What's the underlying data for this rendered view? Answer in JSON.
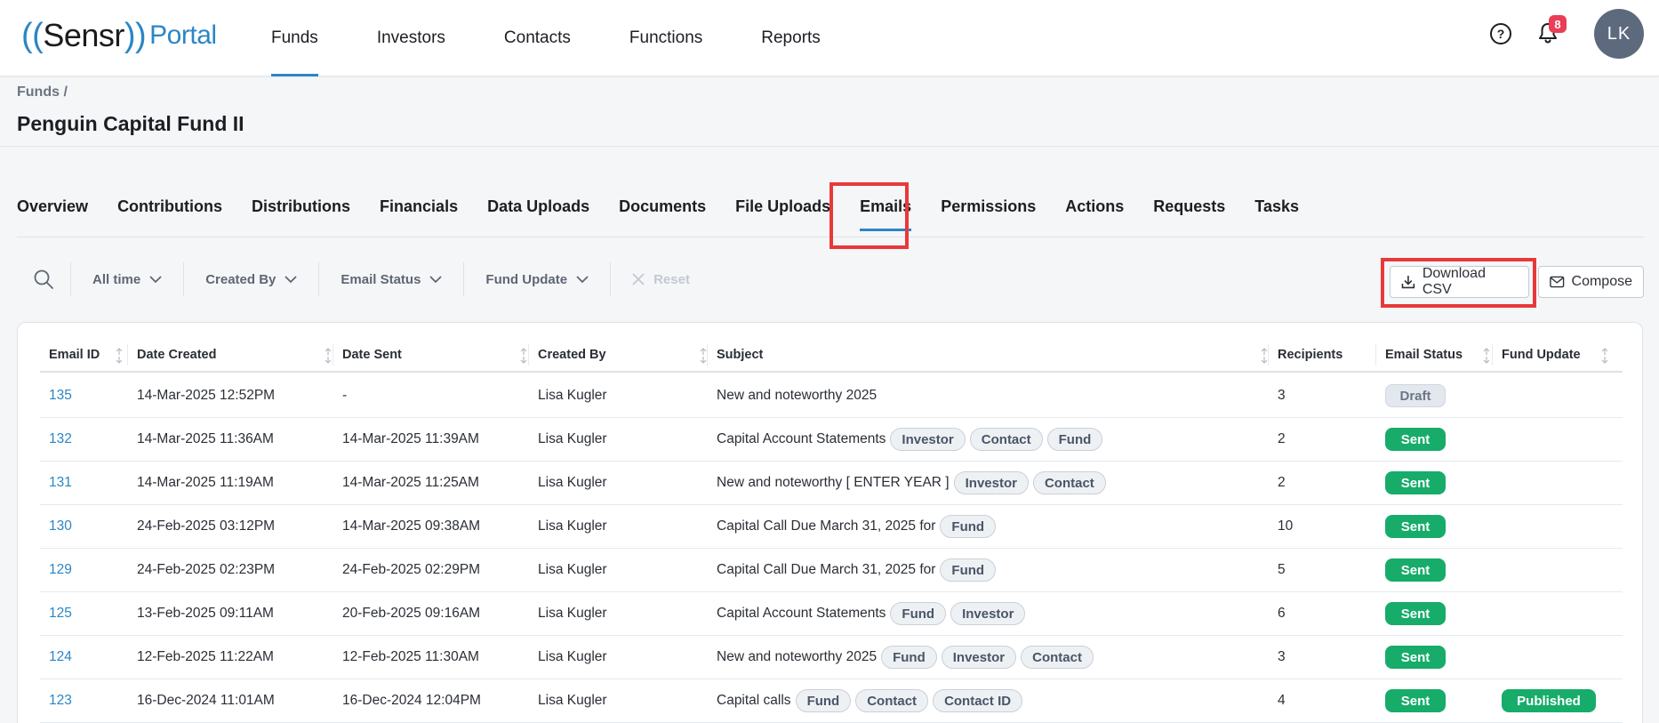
{
  "app": {
    "logo_brand": "Sensr",
    "logo_product": "Portal",
    "nav": [
      "Funds",
      "Investors",
      "Contacts",
      "Functions",
      "Reports"
    ],
    "active_nav": "Funds",
    "help_symbol": "?",
    "notifications_count": "8",
    "avatar_initials": "LK",
    "accent_color": "#2b86c5"
  },
  "page": {
    "breadcrumb": "Funds /",
    "title": "Penguin Capital Fund II"
  },
  "tabs": [
    "Overview",
    "Contributions",
    "Distributions",
    "Financials",
    "Data Uploads",
    "Documents",
    "File Uploads",
    "Emails",
    "Permissions",
    "Actions",
    "Requests",
    "Tasks"
  ],
  "active_tab": "Emails",
  "filters": {
    "time": "All time",
    "created_by": "Created By",
    "email_status": "Email Status",
    "fund_update": "Fund Update",
    "reset": "Reset"
  },
  "actions": {
    "download_csv": "Download CSV",
    "compose": "Compose"
  },
  "table": {
    "columns": [
      "Email ID",
      "Date Created",
      "Date Sent",
      "Created By",
      "Subject",
      "Recipients",
      "Email Status",
      "Fund Update"
    ],
    "rows": [
      {
        "id": "135",
        "created": "14-Mar-2025 12:52PM",
        "sent": "-",
        "by": "Lisa Kugler",
        "subject": "New and noteworthy 2025",
        "tags": [],
        "recipients": "3",
        "status": "Draft",
        "fund_update": ""
      },
      {
        "id": "132",
        "created": "14-Mar-2025 11:36AM",
        "sent": "14-Mar-2025 11:39AM",
        "by": "Lisa Kugler",
        "subject": "Capital Account Statements",
        "tags": [
          "Investor",
          "Contact",
          "Fund"
        ],
        "recipients": "2",
        "status": "Sent",
        "fund_update": ""
      },
      {
        "id": "131",
        "created": "14-Mar-2025 11:19AM",
        "sent": "14-Mar-2025 11:25AM",
        "by": "Lisa Kugler",
        "subject": "New and noteworthy [ ENTER YEAR ]",
        "tags": [
          "Investor",
          "Contact"
        ],
        "recipients": "2",
        "status": "Sent",
        "fund_update": ""
      },
      {
        "id": "130",
        "created": "24-Feb-2025 03:12PM",
        "sent": "14-Mar-2025 09:38AM",
        "by": "Lisa Kugler",
        "subject": "Capital Call Due March 31, 2025 for",
        "tags": [
          "Fund"
        ],
        "recipients": "10",
        "status": "Sent",
        "fund_update": ""
      },
      {
        "id": "129",
        "created": "24-Feb-2025 02:23PM",
        "sent": "24-Feb-2025 02:29PM",
        "by": "Lisa Kugler",
        "subject": "Capital Call Due March 31, 2025 for",
        "tags": [
          "Fund"
        ],
        "recipients": "5",
        "status": "Sent",
        "fund_update": ""
      },
      {
        "id": "125",
        "created": "13-Feb-2025 09:11AM",
        "sent": "20-Feb-2025 09:16AM",
        "by": "Lisa Kugler",
        "subject": "Capital Account Statements",
        "tags": [
          "Fund",
          "Investor"
        ],
        "recipients": "6",
        "status": "Sent",
        "fund_update": ""
      },
      {
        "id": "124",
        "created": "12-Feb-2025 11:22AM",
        "sent": "12-Feb-2025 11:30AM",
        "by": "Lisa Kugler",
        "subject": "New and noteworthy 2025",
        "tags": [
          "Fund",
          "Investor",
          "Contact"
        ],
        "recipients": "3",
        "status": "Sent",
        "fund_update": ""
      },
      {
        "id": "123",
        "created": "16-Dec-2024 11:01AM",
        "sent": "16-Dec-2024 12:04PM",
        "by": "Lisa Kugler",
        "subject": "Capital calls",
        "tags": [
          "Fund",
          "Contact",
          "Contact ID"
        ],
        "recipients": "4",
        "status": "Sent",
        "fund_update": "Published"
      }
    ]
  },
  "colors": {
    "sent": "#17ac6a",
    "highlight": "#e8393a",
    "link": "#2b86c5"
  }
}
